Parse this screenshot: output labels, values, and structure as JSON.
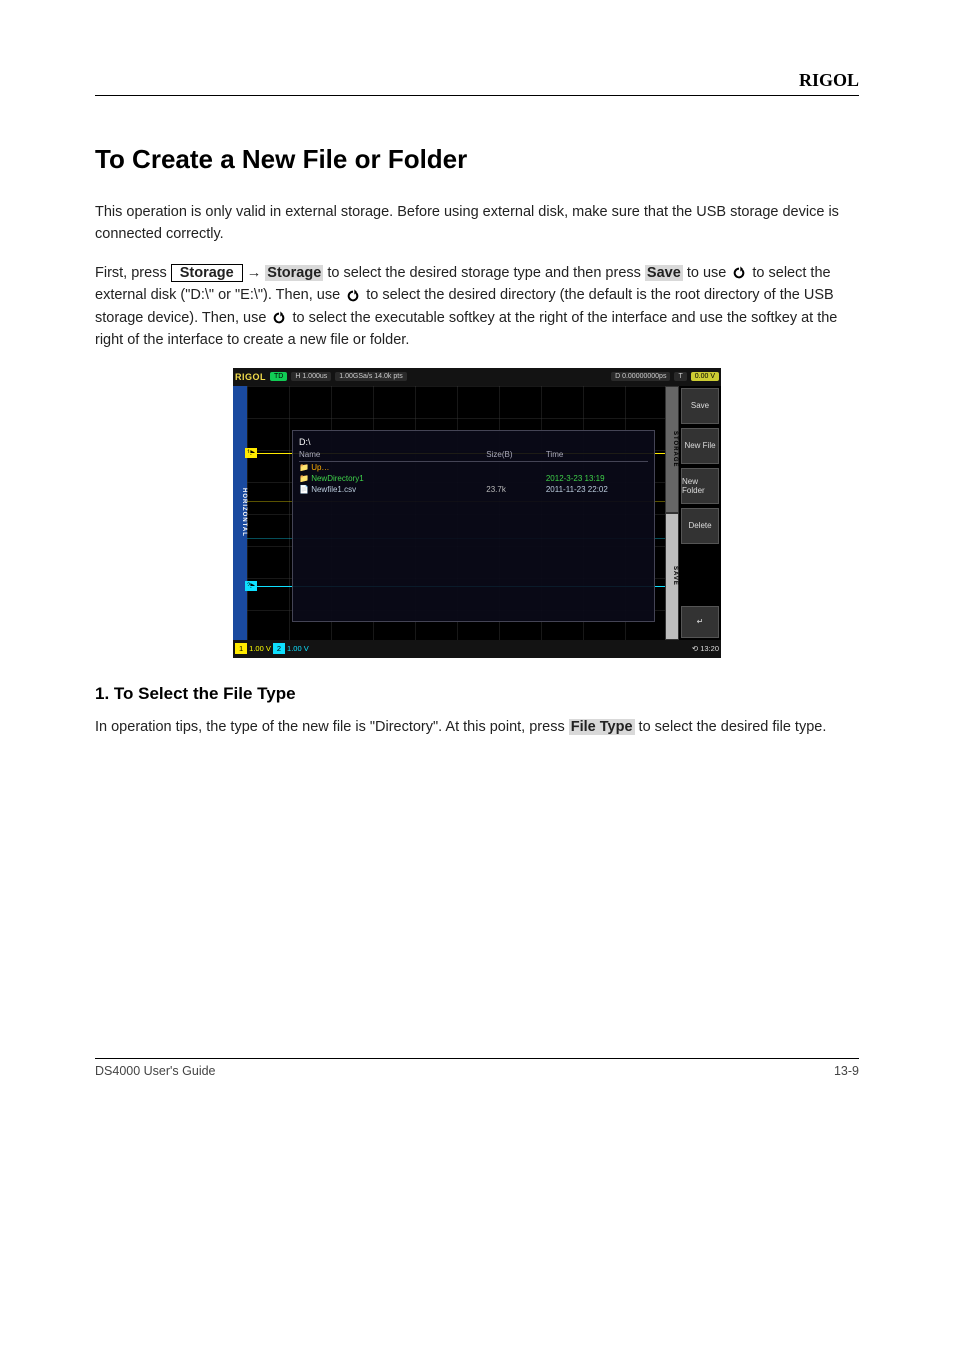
{
  "header": {
    "brand": "RIGOL"
  },
  "title": "To Create a New File or Folder",
  "p1a": "This operation is only valid in external storage. Before using external disk, make sure that the USB storage device is connected correctly.",
  "p1b": "First, press ",
  "key_storage": "Storage",
  "arrow": " → ",
  "sk_storage": "Storage",
  "p1c": " to select the desired storage type and then press ",
  "sk_save": "Save",
  "p1d": " to use ",
  "p1e": " to select the external disk (\"D:\\\" or \"E:\\\"). Then, use ",
  "p1f": " to select the desired directory (the default is the root directory of the USB storage device). Then, use ",
  "p1g": " to select the executable softkey at the right of the interface and use the softkey at the right of the interface to create a new file or folder.",
  "h3": "1.   To Select the File Type",
  "p2a": "In operation tips, the type of the new file is \"Directory\". At this point, press ",
  "sk_filetype": "File Type",
  "p2b": " to select the desired file type.",
  "scope": {
    "brand": "RIGOL",
    "td": "TD",
    "h": "H  1.000us",
    "rate": "1.00GSa/s\n14.0k pts",
    "d": "D  0.00000000ps",
    "t": "T",
    "trig": "0.00 V",
    "horiz": "HORIZONTAL",
    "fb_path": "D:\\",
    "fb_name": "Name",
    "fb_size": "Size(B)",
    "fb_time": "Time",
    "fb_up": "Up…",
    "fb_dir": "NewDirectory1",
    "fb_dir_time": "2012-3-23 13:19",
    "fb_file": "Newfile1.csv",
    "fb_file_size": "23.7k",
    "fb_file_time": "2011-11-23 22:02",
    "tab_storage": "STORAGE",
    "tab_save": "SAVE",
    "b_save": "Save",
    "b_newfile": "New File",
    "b_newfolder": "New Folder",
    "b_delete": "Delete",
    "b_back": "↵",
    "ch1": "1",
    "ch1v": "1.00 V",
    "ch2": "2",
    "ch2v": "1.00 V",
    "clock": "13:20"
  },
  "footer": {
    "left": "DS4000 User's Guide",
    "right": "13-9"
  }
}
